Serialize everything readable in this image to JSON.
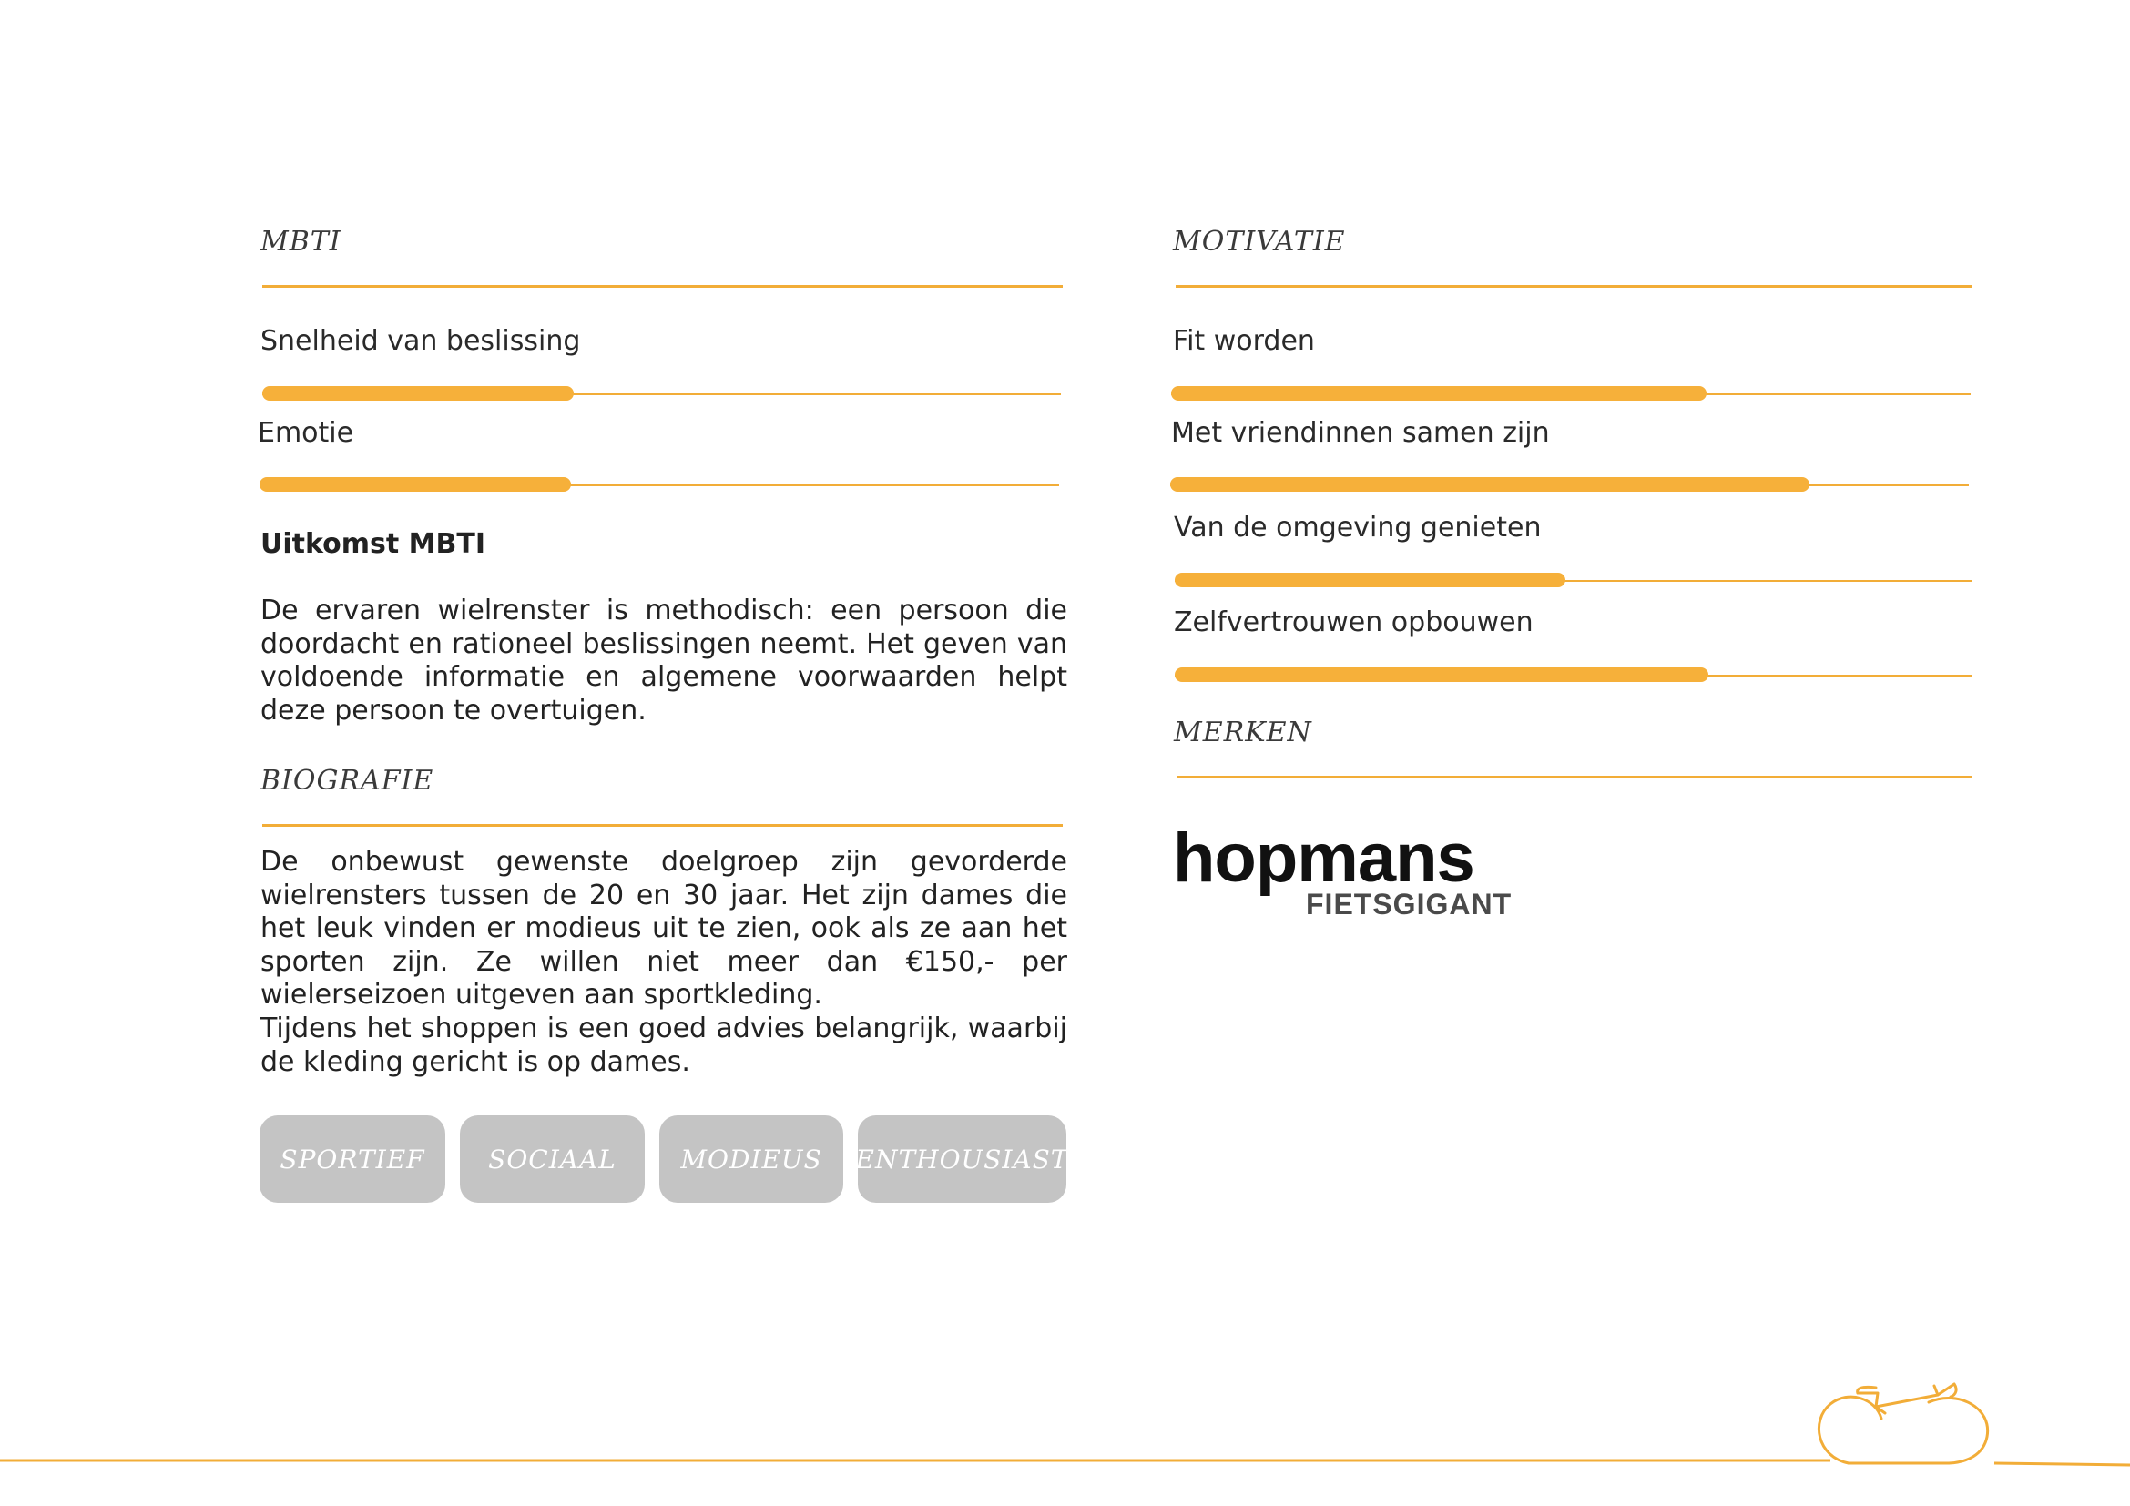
{
  "mbti": {
    "heading": "MBTI",
    "scales": [
      {
        "label": "Snelheid van beslissing",
        "value": 0.39
      },
      {
        "label": "Emotie",
        "value": 0.39
      }
    ],
    "result_title": "Uitkomst MBTI",
    "result_text": "De ervaren wielrenster is methodisch: een persoon die doordacht en rationeel beslissingen neemt. Het geven van voldoende informatie en algemene voorwaarden helpt deze persoon te overtuigen."
  },
  "biografie": {
    "heading": "BIOGRAFIE",
    "paragraph1": "De onbewust gewenste doelgroep zijn gevorderde wielrensters tussen de 20 en 30 jaar. Het zijn dames die het leuk vinden er modieus uit te zien, ook als ze aan het sporten zijn. Ze willen niet meer dan €150,- per wielerseizoen uitgeven aan sportkleding.",
    "paragraph2": "Tijdens het shoppen is een goed advies belangrijk, waarbij de kleding gericht is op dames."
  },
  "tags": [
    "SPORTIEF",
    "SOCIAAL",
    "MODIEUS",
    "ENTHOUSIAST"
  ],
  "motivatie": {
    "heading": "MOTIVATIE",
    "scales": [
      {
        "label": "Fit worden",
        "value": 0.67
      },
      {
        "label": "Met vriendinnen samen zijn",
        "value": 0.8
      },
      {
        "label": "Van de omgeving genieten",
        "value": 0.49
      },
      {
        "label": "Zelfvertrouwen opbouwen",
        "value": 0.67
      }
    ]
  },
  "merken": {
    "heading": "MERKEN",
    "logo_word": "hopmans",
    "logo_sub": "FIETSGIGANT"
  },
  "colors": {
    "accent": "#f6b03a",
    "tag_bg": "#c4c4c4",
    "text": "#222222"
  },
  "icons": [
    "bicycle-icon"
  ]
}
